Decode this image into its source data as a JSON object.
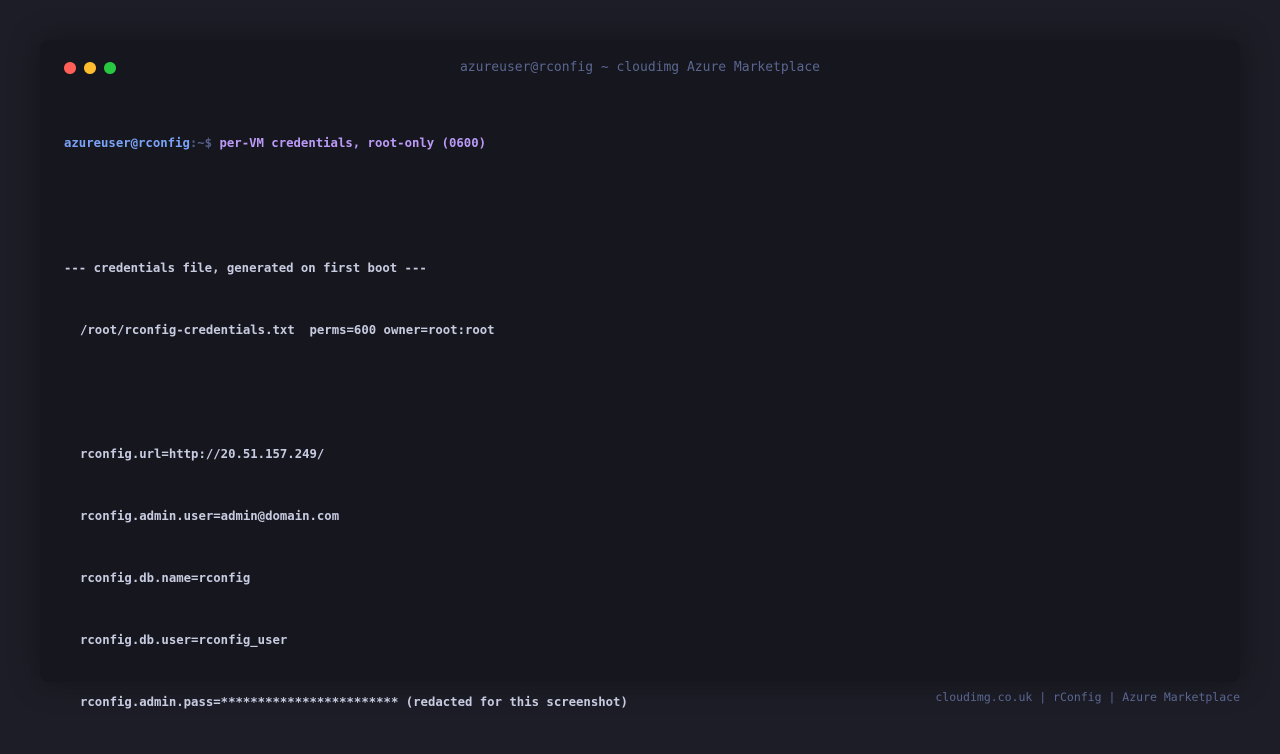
{
  "window": {
    "title": "azureuser@rconfig ~ cloudimg Azure Marketplace"
  },
  "terminal": {
    "prompt_user": "azureuser@rconfig",
    "prompt_path": ":~$ ",
    "command": "per-VM credentials, root-only (0600)",
    "lines": [
      "--- credentials file, generated on first boot ---",
      "/root/rconfig-credentials.txt  perms=600 owner=root:root",
      "rconfig.url=http://20.51.157.249/",
      "rconfig.admin.user=admin@domain.com",
      "rconfig.db.name=rconfig",
      "rconfig.db.user=rconfig_user",
      "rconfig.admin.pass=************************ (redacted for this screenshot)"
    ]
  },
  "footer": {
    "text": "cloudimg.co.uk | rConfig | Azure Marketplace"
  },
  "colors": {
    "background": "#1d1d27",
    "terminal_bg": "#16161e",
    "prompt_user": "#7aa2f7",
    "command": "#bb9af7",
    "text": "#c7cbe0",
    "muted": "#5a6690"
  }
}
